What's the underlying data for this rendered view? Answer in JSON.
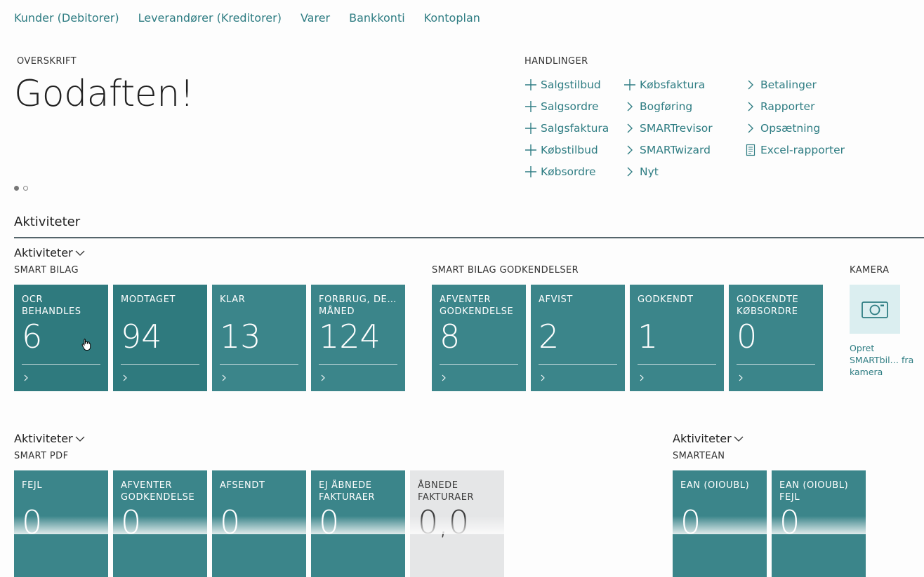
{
  "topnav": [
    {
      "label": "Kunder (Debitorer)"
    },
    {
      "label": "Leverandører (Kreditorer)"
    },
    {
      "label": "Varer"
    },
    {
      "label": "Bankkonti"
    },
    {
      "label": "Kontoplan"
    }
  ],
  "headline": {
    "caption": "OVERSKRIFT",
    "title": "Godaften!"
  },
  "actions": {
    "caption": "HANDLINGER",
    "columns": [
      [
        {
          "label": "Salgstilbud",
          "icon": "plus-icon"
        },
        {
          "label": "Salgsordre",
          "icon": "plus-icon"
        },
        {
          "label": "Salgsfaktura",
          "icon": "plus-icon"
        },
        {
          "label": "Købstilbud",
          "icon": "plus-icon"
        },
        {
          "label": "Købsordre",
          "icon": "plus-icon"
        }
      ],
      [
        {
          "label": "Købsfaktura",
          "icon": "plus-icon"
        },
        {
          "label": "Bogføring",
          "icon": "chevron-right-icon"
        },
        {
          "label": "SMARTrevisor",
          "icon": "chevron-right-icon"
        },
        {
          "label": "SMARTwizard",
          "icon": "chevron-right-icon"
        },
        {
          "label": "Nyt",
          "icon": "chevron-right-icon"
        }
      ],
      [
        {
          "label": "Betalinger",
          "icon": "chevron-right-icon"
        },
        {
          "label": "Rapporter",
          "icon": "chevron-right-icon"
        },
        {
          "label": "Opsætning",
          "icon": "chevron-right-icon"
        },
        {
          "label": "Excel-rapporter",
          "icon": "report-icon"
        }
      ]
    ]
  },
  "activities": {
    "title": "Aktiviteter",
    "toggle_label": "Aktiviteter",
    "smart_bilag": {
      "caption": "SMART BILAG",
      "tiles": [
        {
          "label": "OCR\nBEHANDLES",
          "value": "6"
        },
        {
          "label": "MODTAGET",
          "value": "94"
        },
        {
          "label": "KLAR",
          "value": "13"
        },
        {
          "label": "FORBRUG, DE…\nMÅNED",
          "value": "124"
        }
      ]
    },
    "godkendelser": {
      "caption": "SMART BILAG GODKENDELSER",
      "tiles": [
        {
          "label": "AFVENTER\nGODKENDELSE",
          "value": "8"
        },
        {
          "label": "AFVIST",
          "value": "2"
        },
        {
          "label": "GODKENDT",
          "value": "1"
        },
        {
          "label": "GODKENDTE\nKØBSORDRE",
          "value": "0"
        }
      ]
    },
    "kamera": {
      "caption": "KAMERA",
      "action_label": "Opret SMARTbil… fra kamera"
    },
    "smart_pdf": {
      "toggle_label": "Aktiviteter",
      "caption": "SMART PDF",
      "tiles": [
        {
          "label": "FEJL",
          "value": "0"
        },
        {
          "label": "AFVENTER\nGODKENDELSE",
          "value": "0"
        },
        {
          "label": "AFSENDT",
          "value": "0"
        },
        {
          "label": "EJ ÅBNEDE\nFAKTURAER",
          "value": "0"
        },
        {
          "label": "ÅBNEDE\nFAKTURAER",
          "value": "0,0"
        }
      ]
    },
    "smartean": {
      "toggle_label": "Aktiviteter",
      "caption": "SMARTEAN",
      "tiles": [
        {
          "label": "EAN (OIOUBL)",
          "value": "0"
        },
        {
          "label": "EAN (OIOUBL)\nFEJL",
          "value": "0"
        }
      ]
    }
  },
  "colors": {
    "link": "#2f7d83",
    "tile": "#3b858a",
    "tile_dark": "#2f7a7e",
    "tile_muted": "#e5e6e7",
    "camera_tile": "#dbeef0"
  }
}
